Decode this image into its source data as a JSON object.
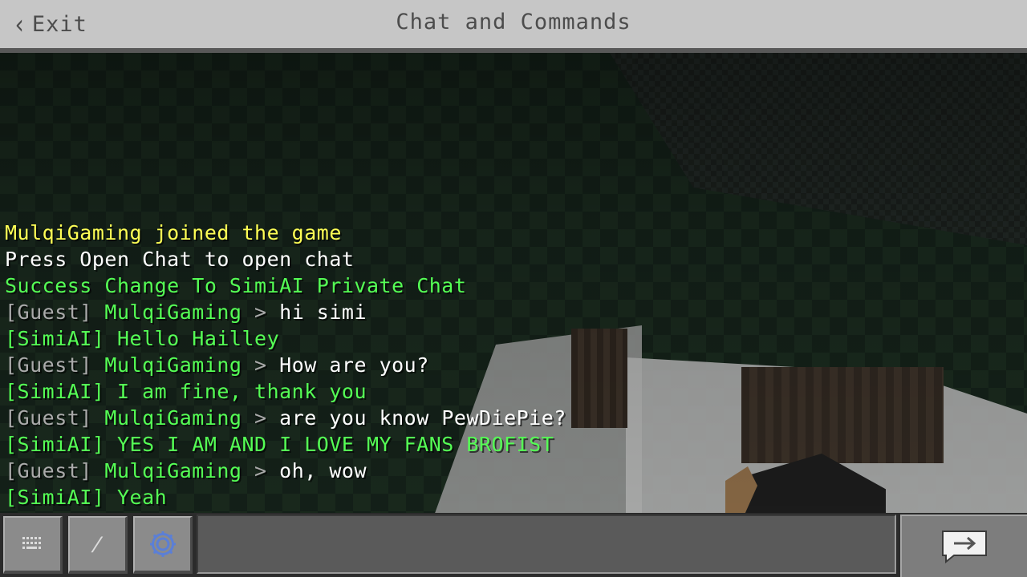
{
  "header": {
    "exit_label": "Exit",
    "title": "Chat and Commands"
  },
  "chat": {
    "lines": [
      {
        "parts": [
          {
            "text": "MulqiGaming joined the game",
            "color": "yellow"
          }
        ]
      },
      {
        "parts": [
          {
            "text": "Press Open Chat to open chat",
            "color": "white"
          }
        ]
      },
      {
        "parts": [
          {
            "text": "Success Change To SimiAI Private Chat",
            "color": "green"
          }
        ]
      },
      {
        "parts": [
          {
            "text": "[Guest] ",
            "color": "gray"
          },
          {
            "text": "MulqiGaming ",
            "color": "green"
          },
          {
            "text": "> ",
            "color": "gray"
          },
          {
            "text": "hi simi",
            "color": "white"
          }
        ]
      },
      {
        "parts": [
          {
            "text": "[SimiAI] ",
            "color": "green"
          },
          {
            "text": "Hello Hailley",
            "color": "green"
          }
        ]
      },
      {
        "parts": [
          {
            "text": "[Guest] ",
            "color": "gray"
          },
          {
            "text": "MulqiGaming ",
            "color": "green"
          },
          {
            "text": "> ",
            "color": "gray"
          },
          {
            "text": "How are you?",
            "color": "white"
          }
        ]
      },
      {
        "parts": [
          {
            "text": "[SimiAI] ",
            "color": "green"
          },
          {
            "text": "I am fine, thank you",
            "color": "green"
          }
        ]
      },
      {
        "parts": [
          {
            "text": "[Guest] ",
            "color": "gray"
          },
          {
            "text": "MulqiGaming ",
            "color": "green"
          },
          {
            "text": "> ",
            "color": "gray"
          },
          {
            "text": "are you know PewDiePie?",
            "color": "white"
          }
        ]
      },
      {
        "parts": [
          {
            "text": "[SimiAI] ",
            "color": "green"
          },
          {
            "text": "YES I AM AND I LOVE MY FANS BROFIST",
            "color": "green"
          }
        ]
      },
      {
        "parts": [
          {
            "text": "[Guest] ",
            "color": "gray"
          },
          {
            "text": "MulqiGaming ",
            "color": "green"
          },
          {
            "text": "> ",
            "color": "gray"
          },
          {
            "text": "oh, wow",
            "color": "white"
          }
        ]
      },
      {
        "parts": [
          {
            "text": "[SimiAI] ",
            "color": "green"
          },
          {
            "text": "Yeah",
            "color": "green"
          }
        ]
      }
    ]
  },
  "toolbar": {
    "keyboard_icon": "keyboard-icon",
    "slash_label": "/",
    "settings_icon": "gear-icon",
    "send_icon": "send-arrow-icon"
  },
  "input": {
    "value": "",
    "placeholder": ""
  },
  "colors": {
    "yellow": "#ffff55",
    "white": "#ffffff",
    "green": "#55ff55",
    "gray": "#aaaaaa"
  }
}
